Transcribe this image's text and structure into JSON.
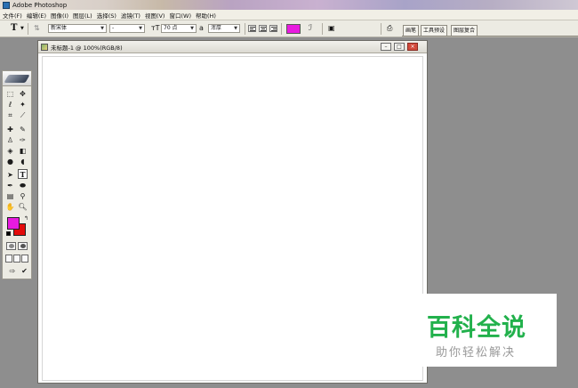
{
  "app": {
    "title": "Adobe Photoshop"
  },
  "menu": [
    "文件(F)",
    "编辑(E)",
    "图像(I)",
    "图层(L)",
    "选择(S)",
    "滤镜(T)",
    "视图(V)",
    "窗口(W)",
    "帮助(H)"
  ],
  "options": {
    "tool_letter": "T",
    "font_family": "新宋体",
    "font_style": "-",
    "font_size": "70 点",
    "aa_label": "a",
    "aa_value": "浑厚",
    "text_color": "#e81adf"
  },
  "palette_tabs": [
    "画笔",
    "工具预设",
    "图层复合"
  ],
  "toolbox": {
    "fg_color": "#e81adf",
    "bg_color": "#e30b0b"
  },
  "document": {
    "title": "未标题-1 @ 100%(RGB/8)"
  },
  "watermark": {
    "title": "百科全说",
    "subtitle": "助你轻松解决"
  }
}
